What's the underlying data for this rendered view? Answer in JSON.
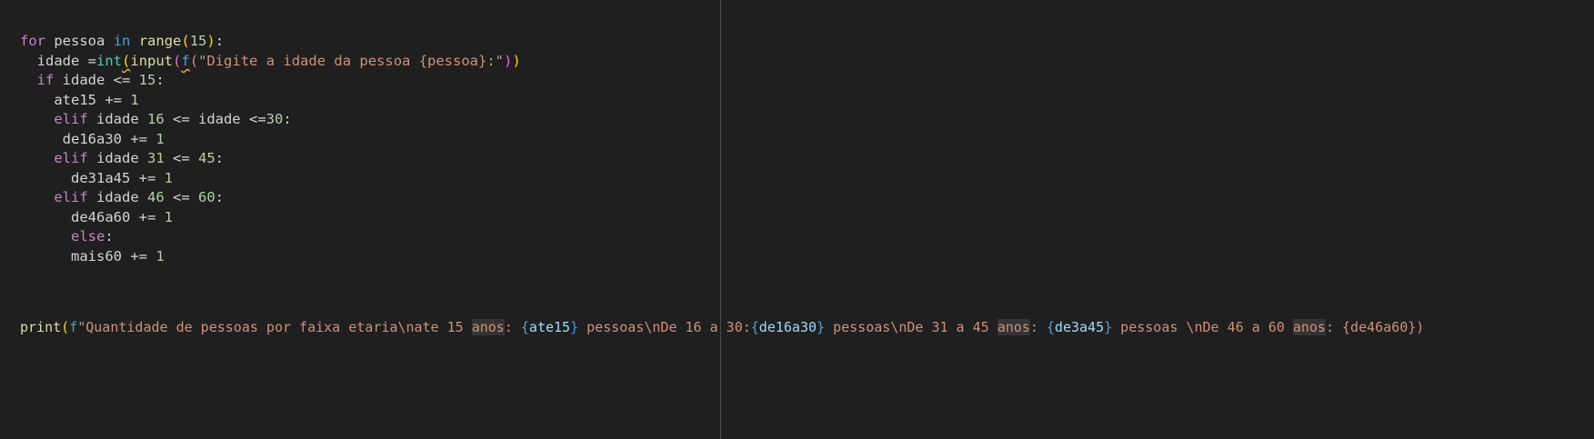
{
  "code": {
    "l1": {
      "kw_for": "for",
      "v": "pessoa",
      "kw_in": "in",
      "fn": "range",
      "p_open": "(",
      "n": "15",
      "p_close": ")",
      "colon": ":"
    },
    "l2": {
      "indent": "  ",
      "v": "idade",
      "eq": " =",
      "fn_int": "int",
      "p1": "(",
      "fn_input": "input",
      "p2": "(",
      "f": "f",
      "p3": "(",
      "s": "\"Digite a idade da pessoa {pessoa}:\"",
      "p4": ")",
      "p5": ")"
    },
    "l3": {
      "indent": "  ",
      "kw": "if",
      "v": " idade ",
      "op": "<=",
      "n": " 15",
      "colon": ":"
    },
    "l4": {
      "indent": "    ",
      "v": "ate15",
      "op": " += ",
      "n": "1"
    },
    "l5": {
      "indent": "    ",
      "kw": "elif",
      "v1": " idade ",
      "n1": "16",
      "op1": " <= ",
      "v2": "idade",
      "op2": " <=",
      "n2": "30",
      "colon": ":"
    },
    "l6": {
      "indent": "     ",
      "v": "de16a30",
      "op": " += ",
      "n": "1"
    },
    "l7": {
      "indent": "    ",
      "kw": "elif",
      "v": " idade ",
      "n1": "31",
      "op": " <= ",
      "n2": "45",
      "colon": ":"
    },
    "l8": {
      "indent": "      ",
      "v": "de31a45",
      "op": " += ",
      "n": "1"
    },
    "l9": {
      "indent": "    ",
      "kw": "elif",
      "v": " idade ",
      "n1": "46",
      "op": " <= ",
      "n2": "60",
      "colon": ":"
    },
    "l10": {
      "indent": "      ",
      "v": "de46a60",
      "op": " += ",
      "n": "1"
    },
    "l11": {
      "indent": "      ",
      "kw": "else",
      "colon": ":"
    },
    "l12": {
      "indent": "      ",
      "v": "mais60",
      "op": " += ",
      "n": "1"
    },
    "l13": {
      "fn": "print",
      "p_open": "(",
      "f": "f",
      "s1": "\"Quantidade de pessoas por faixa etaria\\nate 15 ",
      "anos1": "anos",
      "s2": ": ",
      "b1o": "{",
      "v1": "ate15",
      "b1c": "}",
      "s3": " pessoas\\nDe 16 a 30:",
      "b2o": "{",
      "v2": "de16a30",
      "b2c": "}",
      "s4": " pessoas\\nDe 31 a 45 ",
      "anos2": "anos",
      "s5": ": ",
      "b3o": "{",
      "v3": "de3a45",
      "b3c": "}",
      "s6": " pessoas \\nDe 46 a 60 ",
      "anos3": "anos",
      "s7": ": {de46a60})"
    }
  }
}
